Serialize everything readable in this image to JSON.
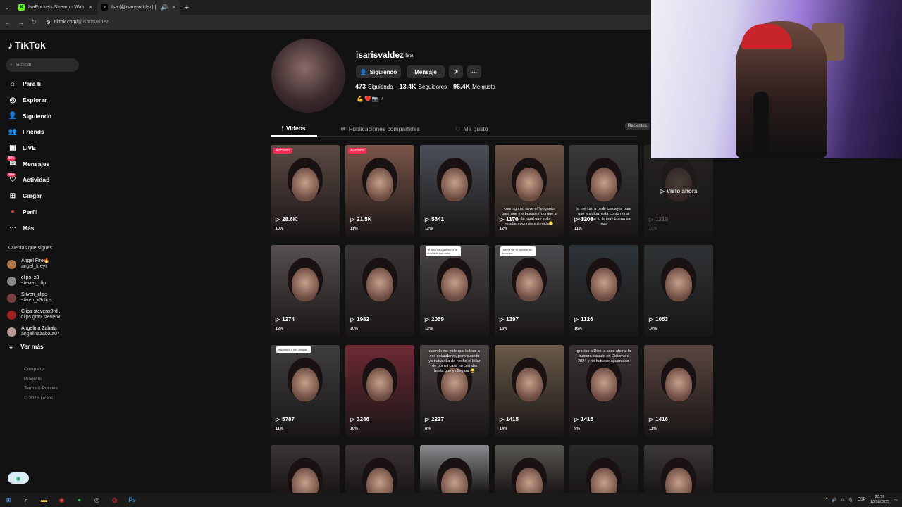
{
  "browser": {
    "tabs": [
      {
        "title": "IsaRockets Stream - Watch Live",
        "active": false
      },
      {
        "title": "Isa (@isarisvaldez) | TikTok",
        "active": true
      }
    ],
    "url_host": "tiktok.com/",
    "url_path": "@isarisvaldez"
  },
  "sidebar": {
    "logo": "TikTok",
    "search_placeholder": "Buscar",
    "nav": [
      {
        "label": "Para ti",
        "icon": "home-icon"
      },
      {
        "label": "Explorar",
        "icon": "compass-icon"
      },
      {
        "label": "Siguiendo",
        "icon": "following-icon"
      },
      {
        "label": "Friends",
        "icon": "friends-icon"
      },
      {
        "label": "LIVE",
        "icon": "live-icon"
      },
      {
        "label": "Mensajes",
        "icon": "messages-icon",
        "badge": "99+"
      },
      {
        "label": "Actividad",
        "icon": "activity-icon",
        "badge": "99+"
      },
      {
        "label": "Cargar",
        "icon": "upload-icon"
      },
      {
        "label": "Perfil",
        "icon": "profile-icon"
      },
      {
        "label": "Más",
        "icon": "more-icon"
      }
    ],
    "following_title": "Cuentas que sigues",
    "following": [
      {
        "name": "Angel Fire🔥",
        "user": "angel_fireyt",
        "color": "#b0784a"
      },
      {
        "name": "clips_x3",
        "user": "steven_clip",
        "color": "#8a8a8a"
      },
      {
        "name": "Stiven_clips",
        "user": "stiven_x3clips",
        "color": "#7a4040"
      },
      {
        "name": "Clips stevenx3rd...",
        "user": "clips.gta5.stevenx",
        "color": "#a02020"
      },
      {
        "name": "Angelina Zabala",
        "user": "angelinazabala07",
        "color": "#b99"
      }
    ],
    "ver_mas": "Ver más",
    "footer": [
      "Company",
      "Program",
      "Terms & Policies",
      "© 2025 TikTok"
    ]
  },
  "profile": {
    "username": "isarisvaldez",
    "nickname": "Isa",
    "btn_following": "Siguiendo",
    "btn_message": "Mensaje",
    "stats": [
      {
        "value": "473",
        "label": "Siguiendo"
      },
      {
        "value": "13.4K",
        "label": "Seguidores"
      },
      {
        "value": "96.4K",
        "label": "Me gusta"
      }
    ],
    "bio": "💪❤️📷♂",
    "tabs": [
      {
        "label": "Videos",
        "active": true
      },
      {
        "label": "Publicaciones compartidas",
        "active": false
      },
      {
        "label": "Me gustó",
        "active": false
      }
    ],
    "sort": "Recientes"
  },
  "videos": [
    {
      "views": "28.6K",
      "pct": "10%",
      "pinned": "Anclado",
      "color": "#5b4a45"
    },
    {
      "views": "21.5K",
      "pct": "11%",
      "pinned": "Anclado",
      "color": "#7a5548"
    },
    {
      "views": "5641",
      "pct": "12%",
      "color": "#4b4f58"
    },
    {
      "views": "1176",
      "pct": "12%",
      "color": "#6e5548",
      "caption": "conmigo no sirve el 'te ignoro para que me busques' porque a mi me da igual que solo resalten por mi existencia😁"
    },
    {
      "views": "1203",
      "pct": "11%",
      "color": "#3d3a3c",
      "caption": "si me van a pedir consejos para que les diga: está como reina, suelta eso, tu te muy buena pa eso"
    },
    {
      "views": "1219",
      "pct": "15%",
      "color": "#2a2626",
      "seen": "Visto ahora"
    },
    {
      "views": "1274",
      "pct": "12%",
      "color": "#565050"
    },
    {
      "views": "1982",
      "pct": "10%",
      "color": "#3a3535"
    },
    {
      "views": "2059",
      "pct": "12%",
      "color": "#4a4545",
      "sticker": "Te amo mi cabello no sé si decirle ese color"
    },
    {
      "views": "1397",
      "pct": "13%",
      "color": "#4b4a4e",
      "sticker": "Quiero ver tu opinión de la fuerza"
    },
    {
      "views": "1126",
      "pct": "16%",
      "color": "#2d3438"
    },
    {
      "views": "1053",
      "pct": "14%",
      "color": "#2f3336"
    },
    {
      "views": "5787",
      "pct": "11%",
      "color": "#3e3d40",
      "sticker": "respuesta a mis amigas"
    },
    {
      "views": "3246",
      "pct": "10%",
      "color": "#6e2a35"
    },
    {
      "views": "2227",
      "pct": "8%",
      "color": "#4a4442",
      "caption": "cuando me pide que le baje a mis estandares, pero cuando yo trabajaba de noche el billar de por mi casa no cerraba hasta que yo llegara 😂"
    },
    {
      "views": "1415",
      "pct": "14%",
      "color": "#6a5a48"
    },
    {
      "views": "1416",
      "pct": "9%",
      "color": "#3a3232",
      "caption": "gracias a Dios la saco ahora, la hubiera sacado en Diciembre 2024 y no hubiese aguantado."
    },
    {
      "views": "1416",
      "pct": "11%",
      "color": "#5a4640"
    },
    {
      "views": "",
      "pct": "",
      "color": "#3a3636"
    },
    {
      "views": "",
      "pct": "",
      "color": "#3c3434"
    },
    {
      "views": "",
      "pct": "",
      "color": "#8a8c90"
    },
    {
      "views": "",
      "pct": "",
      "color": "#5a5852"
    },
    {
      "views": "",
      "pct": "",
      "color": "#2a2a2a"
    },
    {
      "views": "",
      "pct": "",
      "color": "#3c3838"
    }
  ],
  "taskbar": {
    "lang": "ESP",
    "time": "20:56",
    "date": "13/08/2025"
  }
}
